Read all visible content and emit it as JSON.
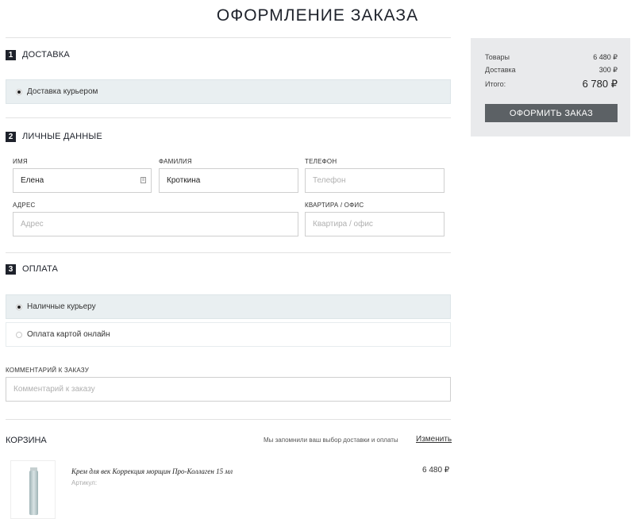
{
  "title": "ОФОРМЛЕНИЕ ЗАКАЗА",
  "delivery": {
    "number": "1",
    "label": "ДОСТАВКА",
    "option": "Доставка курьером"
  },
  "personal": {
    "number": "2",
    "label": "ЛИЧНЫЕ ДАННЫЕ",
    "name_label": "ИМЯ",
    "name_value": "Елена",
    "surname_label": "ФАМИЛИЯ",
    "surname_value": "Кроткина",
    "phone_label": "ТЕЛЕФОН",
    "phone_placeholder": "Телефон",
    "address_label": "АДРЕС",
    "address_placeholder": "Адрес",
    "apt_label": "КВАРТИРА / ОФИС",
    "apt_placeholder": "Квартира / офис"
  },
  "payment": {
    "number": "3",
    "label": "ОПЛАТА",
    "options": [
      "Наличные курьеру",
      "Оплата картой онлайн"
    ]
  },
  "comment": {
    "label": "КОММЕНТАРИЙ К ЗАКАЗУ",
    "placeholder": "Комментарий к заказу"
  },
  "cart": {
    "title": "КОРЗИНА",
    "note": "Мы запомнили ваш выбор доставки и оплаты",
    "change_link": "Изменить",
    "item": {
      "name": "Крем для век Коррекция морщин Про-Коллаген 15 мл",
      "sku_label": "Артикул:",
      "price": "6 480 ₽"
    }
  },
  "summary": {
    "goods_label": "Товары",
    "goods_value": "6 480 ₽",
    "delivery_label": "Доставка",
    "delivery_value": "300 ₽",
    "total_label": "Итого:",
    "total_value": "6 780 ₽",
    "button": "ОФОРМИТЬ ЗАКАЗ"
  },
  "colors": {
    "dark": "#1e222b",
    "selected_bg": "#e9eff1",
    "summary_bg": "#e9eaec",
    "button_bg": "#5c6165"
  }
}
